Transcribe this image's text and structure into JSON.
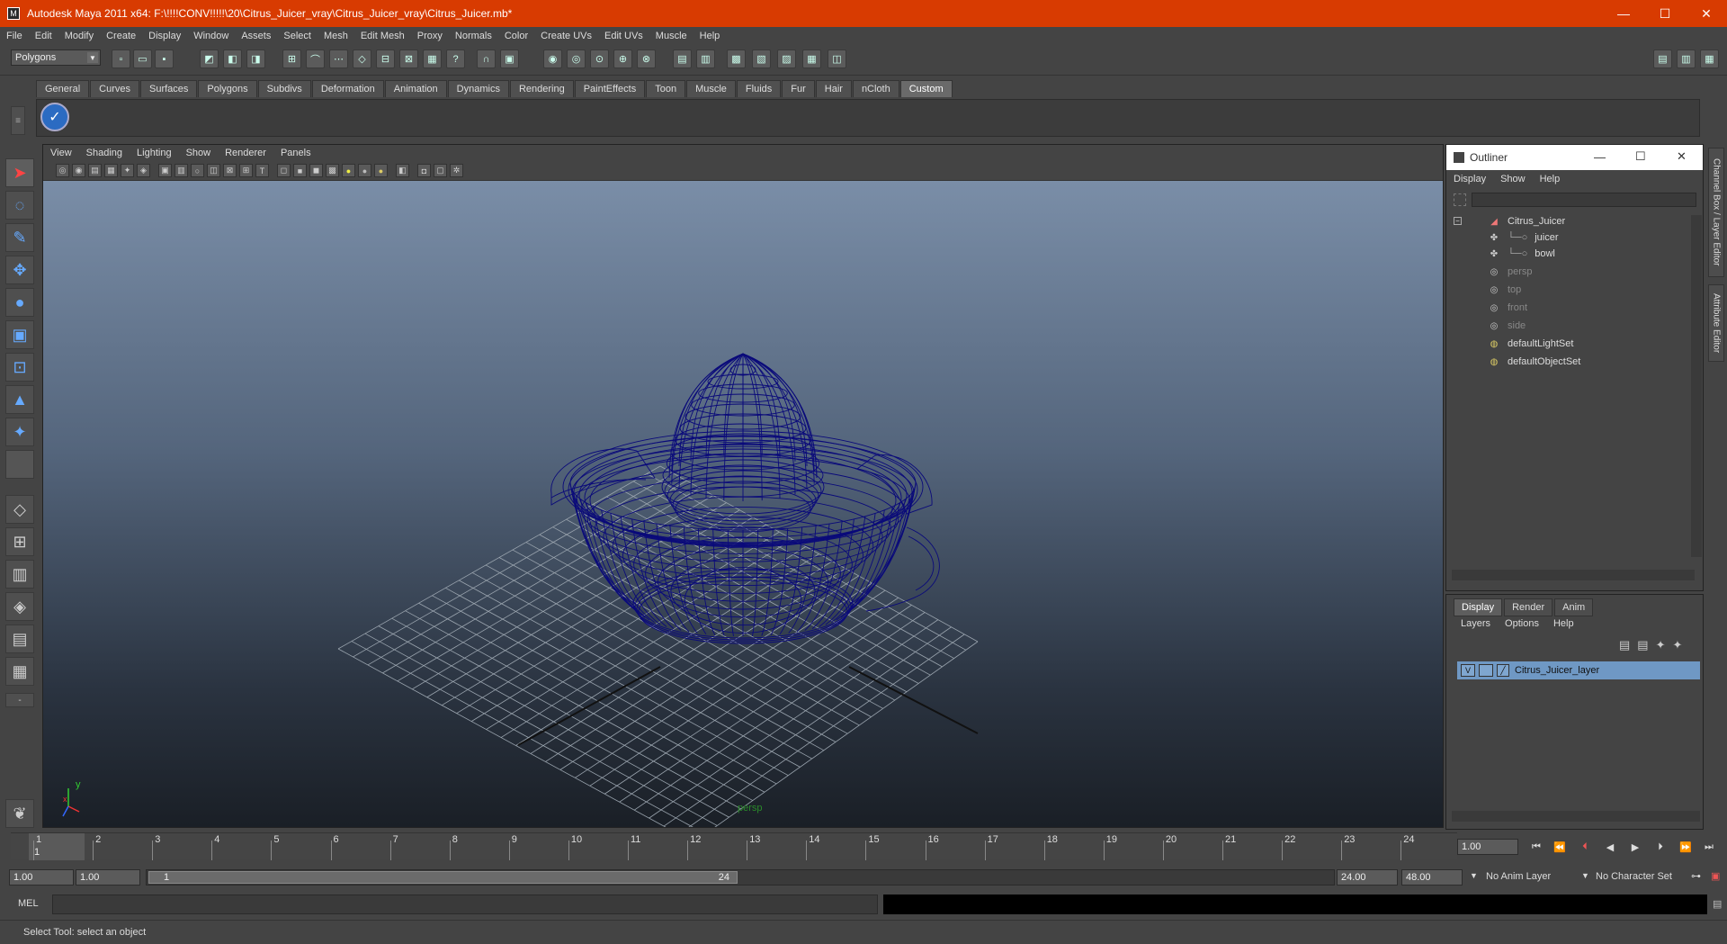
{
  "window": {
    "title": "Autodesk Maya 2011 x64: F:\\!!!!CONV!!!!!\\20\\Citrus_Juicer_vray\\Citrus_Juicer_vray\\Citrus_Juicer.mb*",
    "minimize": "—",
    "maximize": "☐",
    "close": "✕"
  },
  "menubar": [
    "File",
    "Edit",
    "Modify",
    "Create",
    "Display",
    "Window",
    "Assets",
    "Select",
    "Mesh",
    "Edit Mesh",
    "Proxy",
    "Normals",
    "Color",
    "Create UVs",
    "Edit UVs",
    "Muscle",
    "Help"
  ],
  "statusline": {
    "mode": "Polygons"
  },
  "shelf": {
    "tabs": [
      "General",
      "Curves",
      "Surfaces",
      "Polygons",
      "Subdivs",
      "Deformation",
      "Animation",
      "Dynamics",
      "Rendering",
      "PaintEffects",
      "Toon",
      "Muscle",
      "Fluids",
      "Fur",
      "Hair",
      "nCloth",
      "Custom"
    ],
    "active_tab": "Custom"
  },
  "viewport": {
    "menu": [
      "View",
      "Shading",
      "Lighting",
      "Show",
      "Renderer",
      "Panels"
    ],
    "camera_label": "persp",
    "axis_x": "x",
    "axis_y": "y",
    "wire_color": "#0a0a7a"
  },
  "outliner": {
    "title": "Outliner",
    "menu": [
      "Display",
      "Show",
      "Help"
    ],
    "items": [
      {
        "label": "Citrus_Juicer",
        "dim": false
      },
      {
        "label": "juicer",
        "dim": false
      },
      {
        "label": "bowl",
        "dim": false
      },
      {
        "label": "persp",
        "dim": true
      },
      {
        "label": "top",
        "dim": true
      },
      {
        "label": "front",
        "dim": true
      },
      {
        "label": "side",
        "dim": true
      },
      {
        "label": "defaultLightSet",
        "dim": false
      },
      {
        "label": "defaultObjectSet",
        "dim": false
      }
    ]
  },
  "layer_editor": {
    "tabs": [
      "Display",
      "Render",
      "Anim"
    ],
    "active_tab": "Display",
    "menu": [
      "Layers",
      "Options",
      "Help"
    ],
    "layer_visibility": "V",
    "layer_name": "Citrus_Juicer_layer"
  },
  "side_tabs": [
    "Channel Box / Layer Editor",
    "Attribute Editor"
  ],
  "timeline": {
    "ticks": [
      "1",
      "2",
      "3",
      "4",
      "5",
      "6",
      "7",
      "8",
      "9",
      "10",
      "11",
      "12",
      "13",
      "14",
      "15",
      "16",
      "17",
      "18",
      "19",
      "20",
      "21",
      "22",
      "23",
      "24"
    ],
    "current_frame_marker": "1",
    "current_frame": "1.00"
  },
  "range": {
    "start": "1.00",
    "playback_start": "1.00",
    "slider_start": "1",
    "slider_end": "24",
    "playback_end": "24.00",
    "end": "48.00",
    "anim_layer": "No Anim Layer",
    "character_set": "No Character Set"
  },
  "command": {
    "label": "MEL"
  },
  "help_line": "Select Tool: select an object"
}
